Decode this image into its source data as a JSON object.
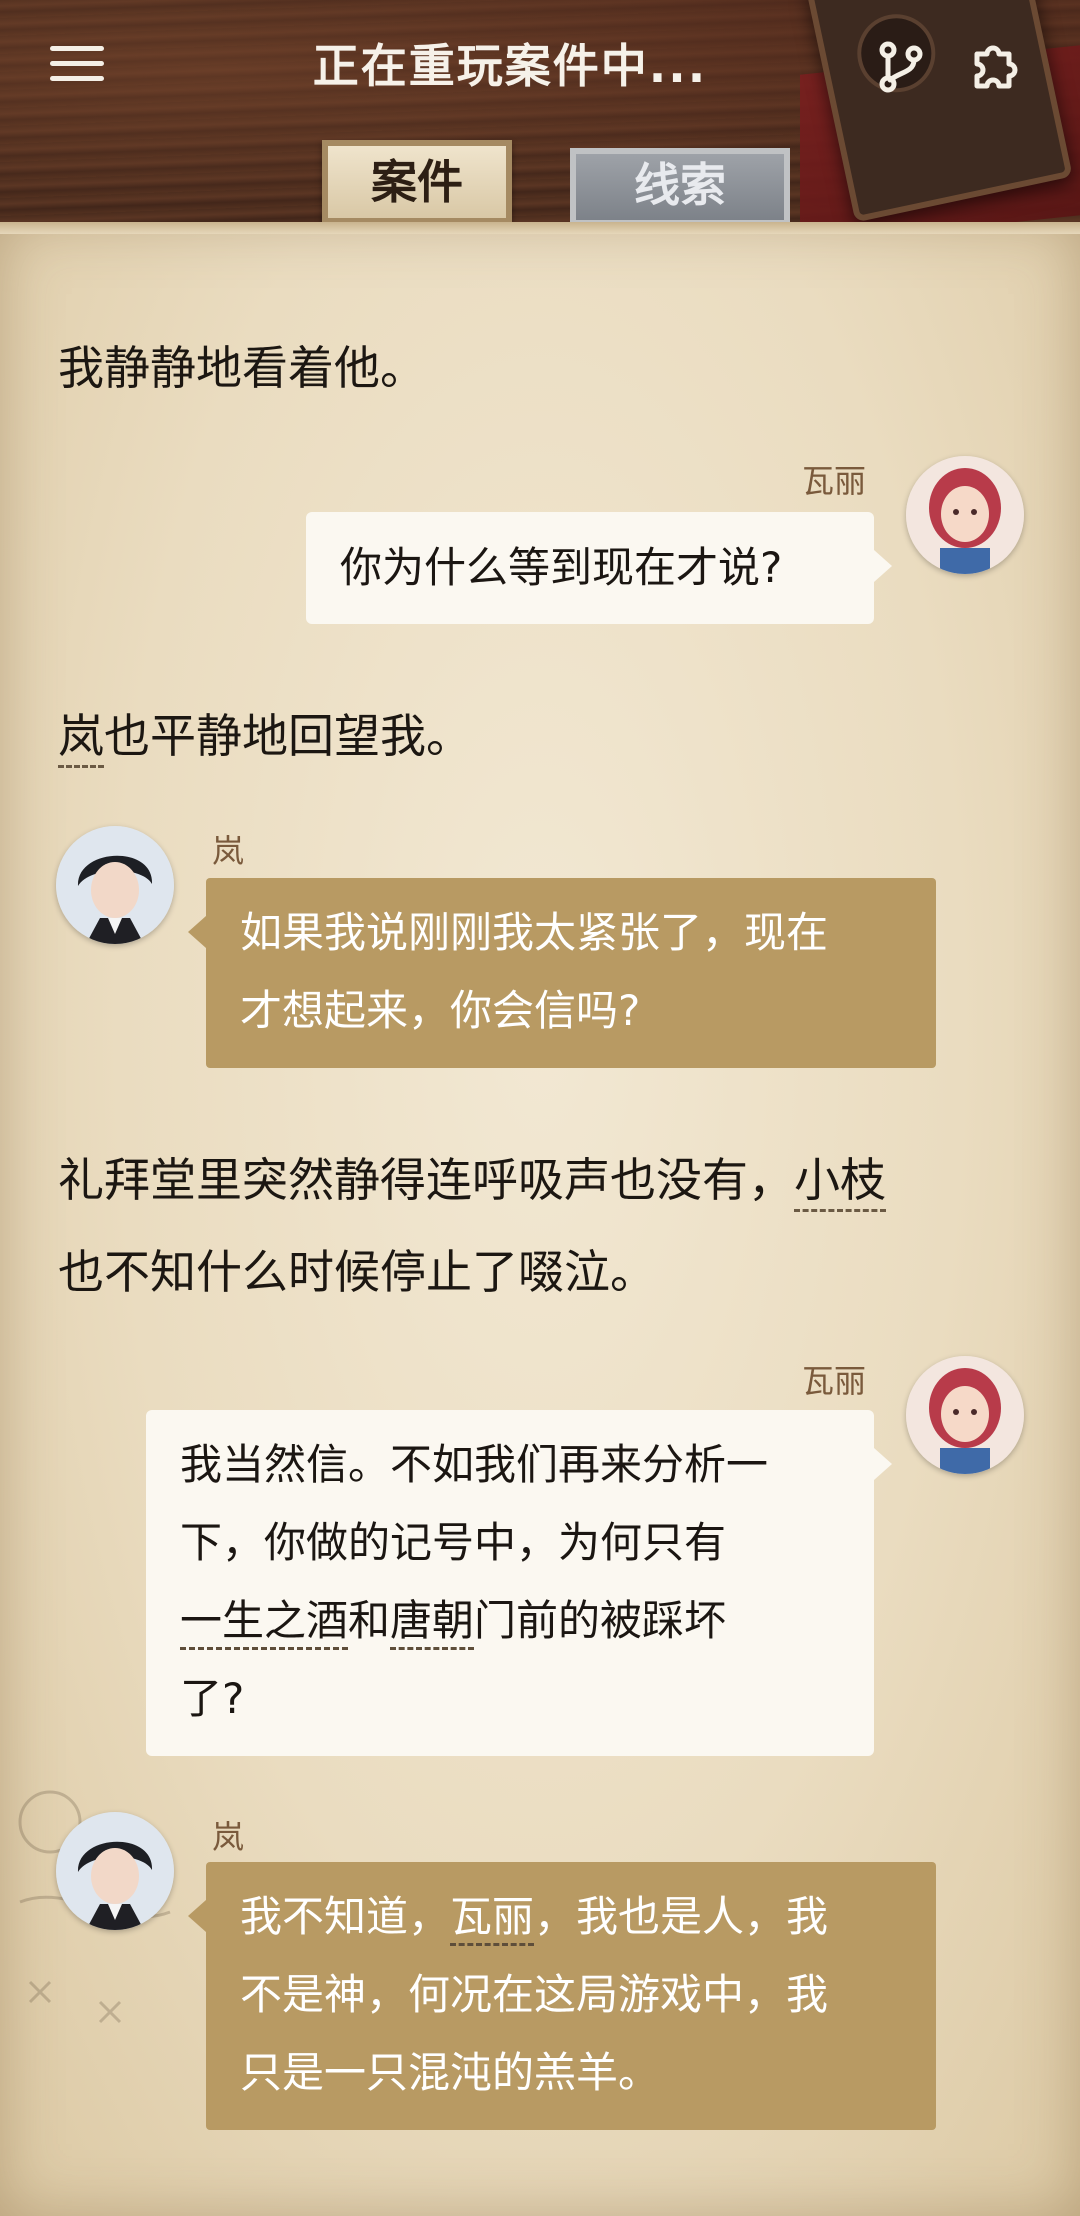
{
  "header": {
    "title": "正在重玩案件中...",
    "menu_icon": "hamburger-menu-icon",
    "branch_icon": "branch-icon",
    "settings_icon": "puzzle-settings-icon"
  },
  "tabs": [
    {
      "label": "案件",
      "active": true
    },
    {
      "label": "线索",
      "active": false
    }
  ],
  "story": [
    {
      "type": "narration",
      "text": "我静静地看着他。"
    },
    {
      "type": "dialogue",
      "speaker": "瓦丽",
      "text": "你为什么等到现在才说?"
    },
    {
      "type": "narration",
      "parts": [
        "岚",
        "也平静地回望我。"
      ]
    },
    {
      "type": "dialogue",
      "speaker": "岚",
      "lines": [
        "如果我说刚刚我太紧张了，现在",
        "才想起来，你会信吗?"
      ]
    },
    {
      "type": "narration",
      "parts": [
        "礼拜堂里突然静得连呼吸声也没有，",
        "小枝",
        "也不知什么时候停止了啜泣。"
      ]
    },
    {
      "type": "dialogue",
      "speaker": "瓦丽",
      "parts": [
        "我当然信。不如我们再来分析一",
        "下，你做的记号中，为何只有",
        "一生之酒",
        "和",
        "唐朝",
        "门前的被踩坏",
        "了?"
      ]
    },
    {
      "type": "dialogue",
      "speaker": "岚",
      "parts": [
        "我不知道，",
        "瓦丽",
        "，我也是人，我",
        "不是神，何况在这局游戏中，我",
        "只是一只混沌的羔羊。"
      ]
    }
  ],
  "colors": {
    "paper": "#eadcc0",
    "bubble_white": "#fbf8f1",
    "bubble_brown": "#b89a63",
    "speaker_name": "#7a5a3c"
  }
}
